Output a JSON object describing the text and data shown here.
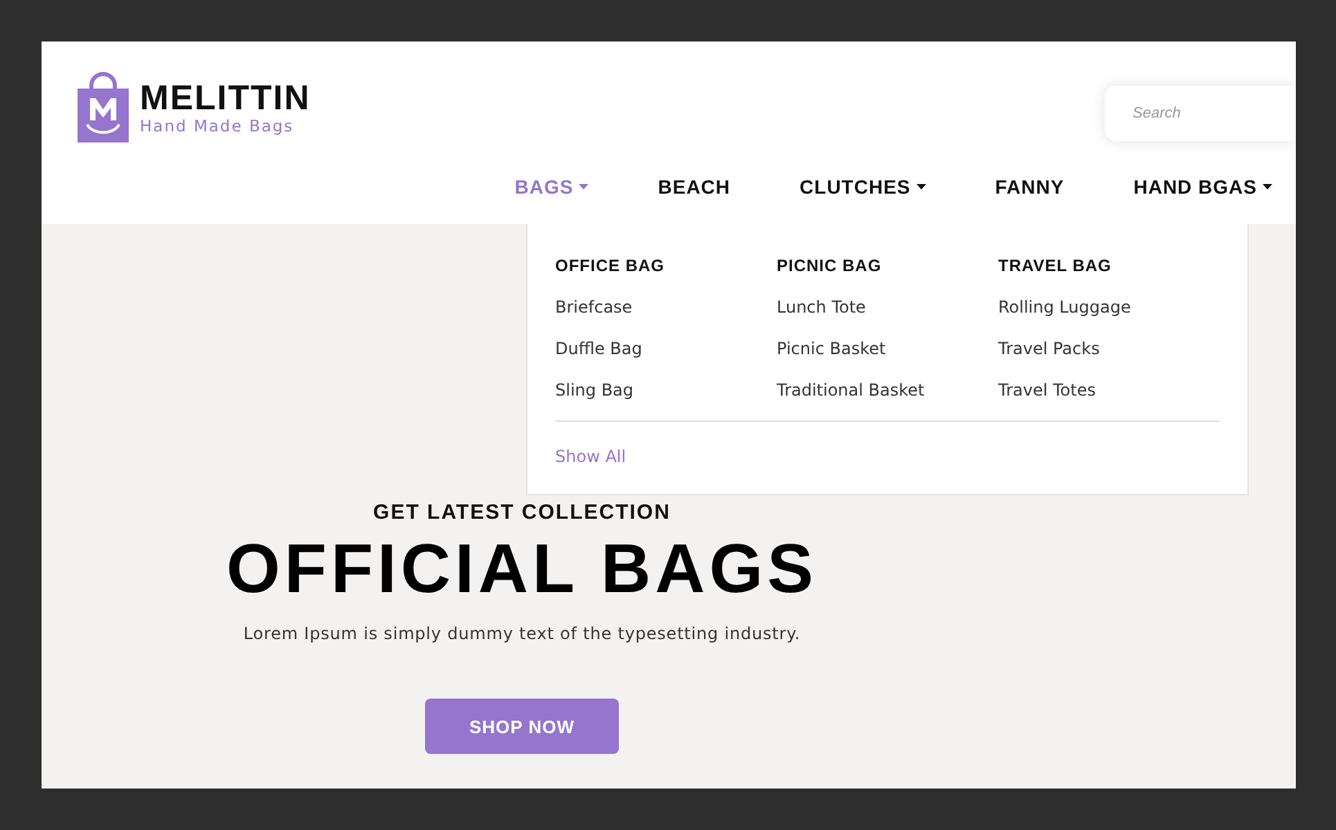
{
  "logo": {
    "name": "MELITTIN",
    "tagline": "Hand Made Bags"
  },
  "search": {
    "placeholder": "Search"
  },
  "nav": [
    {
      "label": "BAGS",
      "selected": true,
      "dropdown": true
    },
    {
      "label": "BEACH",
      "selected": false,
      "dropdown": false
    },
    {
      "label": "CLUTCHES",
      "selected": false,
      "dropdown": true
    },
    {
      "label": "FANNY",
      "selected": false,
      "dropdown": false
    },
    {
      "label": "HAND BGAS",
      "selected": false,
      "dropdown": true
    }
  ],
  "mega_menu": {
    "columns": [
      {
        "heading": "OFFICE BAG",
        "items": [
          "Briefcase",
          "Duffle Bag",
          "Sling Bag"
        ]
      },
      {
        "heading": "PICNIC BAG",
        "items": [
          "Lunch Tote",
          "Picnic Basket",
          "Traditional Basket"
        ]
      },
      {
        "heading": "TRAVEL BAG",
        "items": [
          "Rolling Luggage",
          "Travel Packs",
          "Travel Totes"
        ]
      }
    ],
    "show_all": "Show All"
  },
  "hero": {
    "eyebrow": "GET LATEST COLLECTION",
    "title": "OFFICIAL BAGS",
    "text": "Lorem Ipsum is simply dummy text of the typesetting industry.",
    "button": "SHOP NOW"
  }
}
